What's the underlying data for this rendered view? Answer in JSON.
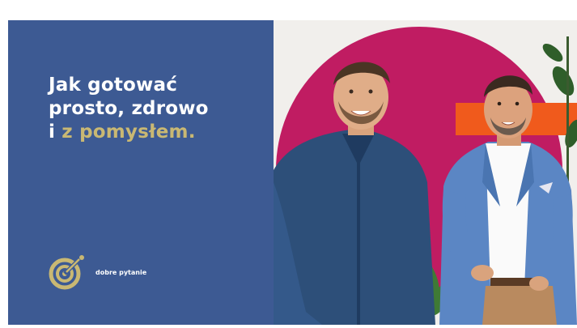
{
  "headline": {
    "line1": "Jak gotować",
    "line2": "prosto, zdrowo",
    "line3_prefix": "i ",
    "line3_accent": "z pomysłem."
  },
  "brand": {
    "name": "dobre pytanie",
    "icon": "target-logo-icon"
  },
  "colors": {
    "panel": "#3d5a93",
    "accent": "#c9b873",
    "circle": "#c01c62",
    "orange": "#f05a1c"
  }
}
